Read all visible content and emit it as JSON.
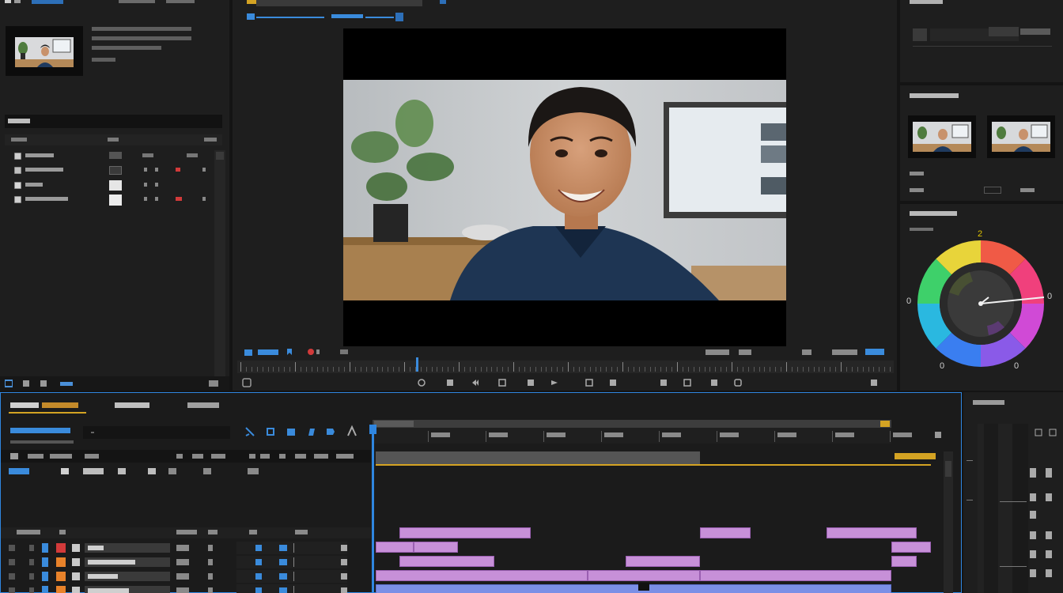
{
  "project": {
    "label_top": "",
    "thumb_lines": [
      "",
      "",
      ""
    ],
    "section_title": "",
    "col_a": "",
    "col_b": "",
    "col_c": "",
    "items": [
      {
        "name": "",
        "color": ""
      },
      {
        "name": "",
        "color": ""
      },
      {
        "name": "",
        "color": ""
      },
      {
        "name": "",
        "color": ""
      }
    ]
  },
  "viewer": {
    "tab_label": "",
    "footer_left": "",
    "footer_right": ""
  },
  "inspector": {
    "top_title": "",
    "media_title": "",
    "media_footer_left": "",
    "media_footer_right": "",
    "color_title": "",
    "color_sub": "",
    "wheel_labels": {
      "top": "2",
      "left": "0",
      "right": "0",
      "bottom_left": "0",
      "bottom_right": "0"
    }
  },
  "timeline": {
    "tabs": [
      "",
      "",
      ""
    ],
    "sequence_name": "",
    "sequence_sub": "",
    "ruler_labels": [
      "",
      "",
      "",
      "",
      "",
      "",
      "",
      "",
      ""
    ],
    "track_header_a": "",
    "track_header_b": "",
    "playhead_color": "#2f86e0",
    "marker_color": "#d4a323",
    "clip_color": "#c790d8",
    "video_clip_color": "#7b8fe6"
  }
}
